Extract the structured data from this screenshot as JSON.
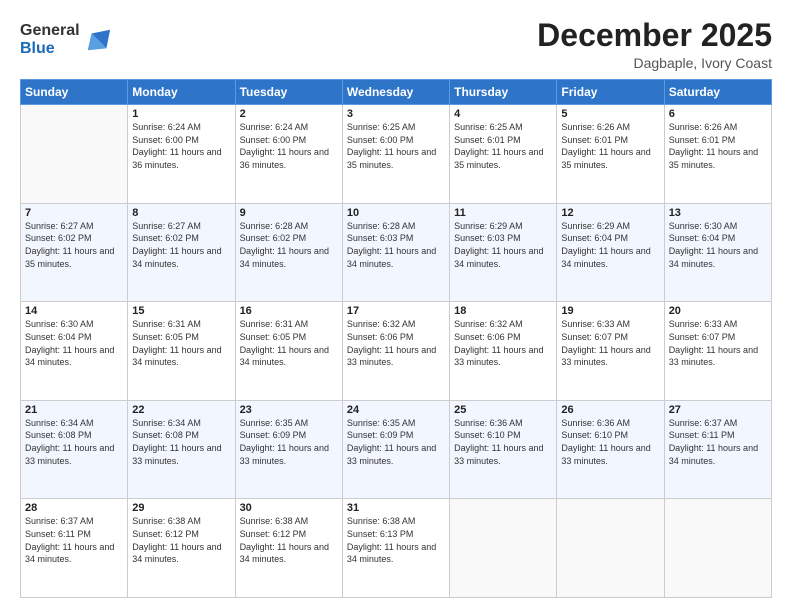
{
  "logo": {
    "general": "General",
    "blue": "Blue"
  },
  "title": "December 2025",
  "location": "Dagbaple, Ivory Coast",
  "days_header": [
    "Sunday",
    "Monday",
    "Tuesday",
    "Wednesday",
    "Thursday",
    "Friday",
    "Saturday"
  ],
  "weeks": [
    [
      {
        "day": "",
        "sunrise": "",
        "sunset": "",
        "daylight": ""
      },
      {
        "day": "1",
        "sunrise": "Sunrise: 6:24 AM",
        "sunset": "Sunset: 6:00 PM",
        "daylight": "Daylight: 11 hours and 36 minutes."
      },
      {
        "day": "2",
        "sunrise": "Sunrise: 6:24 AM",
        "sunset": "Sunset: 6:00 PM",
        "daylight": "Daylight: 11 hours and 36 minutes."
      },
      {
        "day": "3",
        "sunrise": "Sunrise: 6:25 AM",
        "sunset": "Sunset: 6:00 PM",
        "daylight": "Daylight: 11 hours and 35 minutes."
      },
      {
        "day": "4",
        "sunrise": "Sunrise: 6:25 AM",
        "sunset": "Sunset: 6:01 PM",
        "daylight": "Daylight: 11 hours and 35 minutes."
      },
      {
        "day": "5",
        "sunrise": "Sunrise: 6:26 AM",
        "sunset": "Sunset: 6:01 PM",
        "daylight": "Daylight: 11 hours and 35 minutes."
      },
      {
        "day": "6",
        "sunrise": "Sunrise: 6:26 AM",
        "sunset": "Sunset: 6:01 PM",
        "daylight": "Daylight: 11 hours and 35 minutes."
      }
    ],
    [
      {
        "day": "7",
        "sunrise": "Sunrise: 6:27 AM",
        "sunset": "Sunset: 6:02 PM",
        "daylight": "Daylight: 11 hours and 35 minutes."
      },
      {
        "day": "8",
        "sunrise": "Sunrise: 6:27 AM",
        "sunset": "Sunset: 6:02 PM",
        "daylight": "Daylight: 11 hours and 34 minutes."
      },
      {
        "day": "9",
        "sunrise": "Sunrise: 6:28 AM",
        "sunset": "Sunset: 6:02 PM",
        "daylight": "Daylight: 11 hours and 34 minutes."
      },
      {
        "day": "10",
        "sunrise": "Sunrise: 6:28 AM",
        "sunset": "Sunset: 6:03 PM",
        "daylight": "Daylight: 11 hours and 34 minutes."
      },
      {
        "day": "11",
        "sunrise": "Sunrise: 6:29 AM",
        "sunset": "Sunset: 6:03 PM",
        "daylight": "Daylight: 11 hours and 34 minutes."
      },
      {
        "day": "12",
        "sunrise": "Sunrise: 6:29 AM",
        "sunset": "Sunset: 6:04 PM",
        "daylight": "Daylight: 11 hours and 34 minutes."
      },
      {
        "day": "13",
        "sunrise": "Sunrise: 6:30 AM",
        "sunset": "Sunset: 6:04 PM",
        "daylight": "Daylight: 11 hours and 34 minutes."
      }
    ],
    [
      {
        "day": "14",
        "sunrise": "Sunrise: 6:30 AM",
        "sunset": "Sunset: 6:04 PM",
        "daylight": "Daylight: 11 hours and 34 minutes."
      },
      {
        "day": "15",
        "sunrise": "Sunrise: 6:31 AM",
        "sunset": "Sunset: 6:05 PM",
        "daylight": "Daylight: 11 hours and 34 minutes."
      },
      {
        "day": "16",
        "sunrise": "Sunrise: 6:31 AM",
        "sunset": "Sunset: 6:05 PM",
        "daylight": "Daylight: 11 hours and 34 minutes."
      },
      {
        "day": "17",
        "sunrise": "Sunrise: 6:32 AM",
        "sunset": "Sunset: 6:06 PM",
        "daylight": "Daylight: 11 hours and 33 minutes."
      },
      {
        "day": "18",
        "sunrise": "Sunrise: 6:32 AM",
        "sunset": "Sunset: 6:06 PM",
        "daylight": "Daylight: 11 hours and 33 minutes."
      },
      {
        "day": "19",
        "sunrise": "Sunrise: 6:33 AM",
        "sunset": "Sunset: 6:07 PM",
        "daylight": "Daylight: 11 hours and 33 minutes."
      },
      {
        "day": "20",
        "sunrise": "Sunrise: 6:33 AM",
        "sunset": "Sunset: 6:07 PM",
        "daylight": "Daylight: 11 hours and 33 minutes."
      }
    ],
    [
      {
        "day": "21",
        "sunrise": "Sunrise: 6:34 AM",
        "sunset": "Sunset: 6:08 PM",
        "daylight": "Daylight: 11 hours and 33 minutes."
      },
      {
        "day": "22",
        "sunrise": "Sunrise: 6:34 AM",
        "sunset": "Sunset: 6:08 PM",
        "daylight": "Daylight: 11 hours and 33 minutes."
      },
      {
        "day": "23",
        "sunrise": "Sunrise: 6:35 AM",
        "sunset": "Sunset: 6:09 PM",
        "daylight": "Daylight: 11 hours and 33 minutes."
      },
      {
        "day": "24",
        "sunrise": "Sunrise: 6:35 AM",
        "sunset": "Sunset: 6:09 PM",
        "daylight": "Daylight: 11 hours and 33 minutes."
      },
      {
        "day": "25",
        "sunrise": "Sunrise: 6:36 AM",
        "sunset": "Sunset: 6:10 PM",
        "daylight": "Daylight: 11 hours and 33 minutes."
      },
      {
        "day": "26",
        "sunrise": "Sunrise: 6:36 AM",
        "sunset": "Sunset: 6:10 PM",
        "daylight": "Daylight: 11 hours and 33 minutes."
      },
      {
        "day": "27",
        "sunrise": "Sunrise: 6:37 AM",
        "sunset": "Sunset: 6:11 PM",
        "daylight": "Daylight: 11 hours and 34 minutes."
      }
    ],
    [
      {
        "day": "28",
        "sunrise": "Sunrise: 6:37 AM",
        "sunset": "Sunset: 6:11 PM",
        "daylight": "Daylight: 11 hours and 34 minutes."
      },
      {
        "day": "29",
        "sunrise": "Sunrise: 6:38 AM",
        "sunset": "Sunset: 6:12 PM",
        "daylight": "Daylight: 11 hours and 34 minutes."
      },
      {
        "day": "30",
        "sunrise": "Sunrise: 6:38 AM",
        "sunset": "Sunset: 6:12 PM",
        "daylight": "Daylight: 11 hours and 34 minutes."
      },
      {
        "day": "31",
        "sunrise": "Sunrise: 6:38 AM",
        "sunset": "Sunset: 6:13 PM",
        "daylight": "Daylight: 11 hours and 34 minutes."
      },
      {
        "day": "",
        "sunrise": "",
        "sunset": "",
        "daylight": ""
      },
      {
        "day": "",
        "sunrise": "",
        "sunset": "",
        "daylight": ""
      },
      {
        "day": "",
        "sunrise": "",
        "sunset": "",
        "daylight": ""
      }
    ]
  ]
}
